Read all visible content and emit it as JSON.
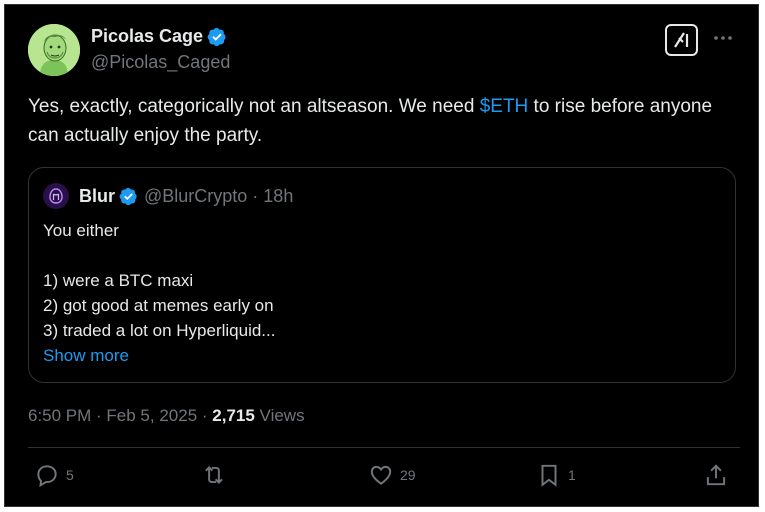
{
  "author": {
    "display_name": "Picolas Cage",
    "handle": "@Picolas_Caged"
  },
  "tweet": {
    "text_before": "Yes, exactly, categorically not an altseason. We need ",
    "cashtag": "$ETH",
    "text_after": " to rise before anyone can actually enjoy the party."
  },
  "quote": {
    "display_name": "Blur",
    "meta": "@BlurCrypto · 18h",
    "lines": [
      "You either",
      "1) were a BTC maxi",
      "2) got good at memes early on",
      "3) traded a lot on Hyperliquid..."
    ],
    "show_more": "Show more"
  },
  "meta": {
    "timestamp": "6:50 PM · Feb 5, 2025 · ",
    "views_count": "2,715",
    "views_label": " Views"
  },
  "actions": {
    "replies": "5",
    "likes": "29",
    "bookmarks": "1"
  },
  "icons": [
    "verified-icon",
    "grok-icon",
    "more-icon",
    "reply-icon",
    "retweet-icon",
    "like-icon",
    "bookmark-icon",
    "share-icon"
  ],
  "colors": {
    "background": "#000000",
    "text": "#e7e9ea",
    "muted": "#71767b",
    "accent": "#1d9bf0",
    "border": "#2f3336"
  }
}
